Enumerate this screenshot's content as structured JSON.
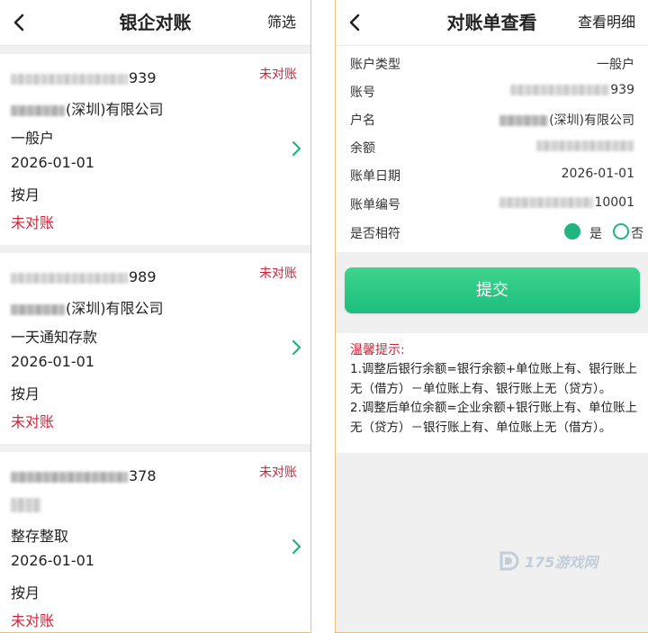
{
  "left": {
    "title": "银企对账",
    "action": "筛选",
    "cards": [
      {
        "account_suffix": "939",
        "company_suffix": "(深圳)有限公司",
        "account_type": "一般户",
        "date": "2026-01-01",
        "period": "按月",
        "status": "未对账",
        "badge": "未对账"
      },
      {
        "account_suffix": "989",
        "company_suffix": "(深圳)有限公司",
        "account_type": "一天通知存款",
        "date": "2026-01-01",
        "period": "按月",
        "status": "未对账",
        "badge": "未对账"
      },
      {
        "account_suffix": "378",
        "company_suffix": "",
        "account_type": "整存整取",
        "date": "2026-01-01",
        "period": "按月",
        "status": "未对账",
        "badge": "未对账"
      }
    ]
  },
  "right": {
    "title": "对账单查看",
    "action": "查看明细",
    "rows": {
      "type_label": "账户类型",
      "type_value": "一般户",
      "account_label": "账号",
      "account_suffix": "939",
      "name_label": "户名",
      "name_suffix": "(深圳)有限公司",
      "balance_label": "余额",
      "date_label": "账单日期",
      "date_value": "2026-01-01",
      "no_label": "账单编号",
      "no_suffix": "10001",
      "match_label": "是否相符",
      "yes_label": "是",
      "no_option_label": "否"
    },
    "submit_label": "提交",
    "tips_title": "温馨提示:",
    "tips_line1": "1.调整后银行余额=银行余额+单位账上有、银行账上无（借方）－单位账上有、银行账上无（贷方）。",
    "tips_line2": "2.调整后单位余额=企业余额+银行账上有、单位账上无（贷方）－银行账上有、单位账上无（借方）。",
    "watermark": "175游戏网"
  },
  "colors": {
    "accent_green": "#1fb57e",
    "status_red": "#d1233a",
    "frame_gold": "#e7c27c"
  }
}
